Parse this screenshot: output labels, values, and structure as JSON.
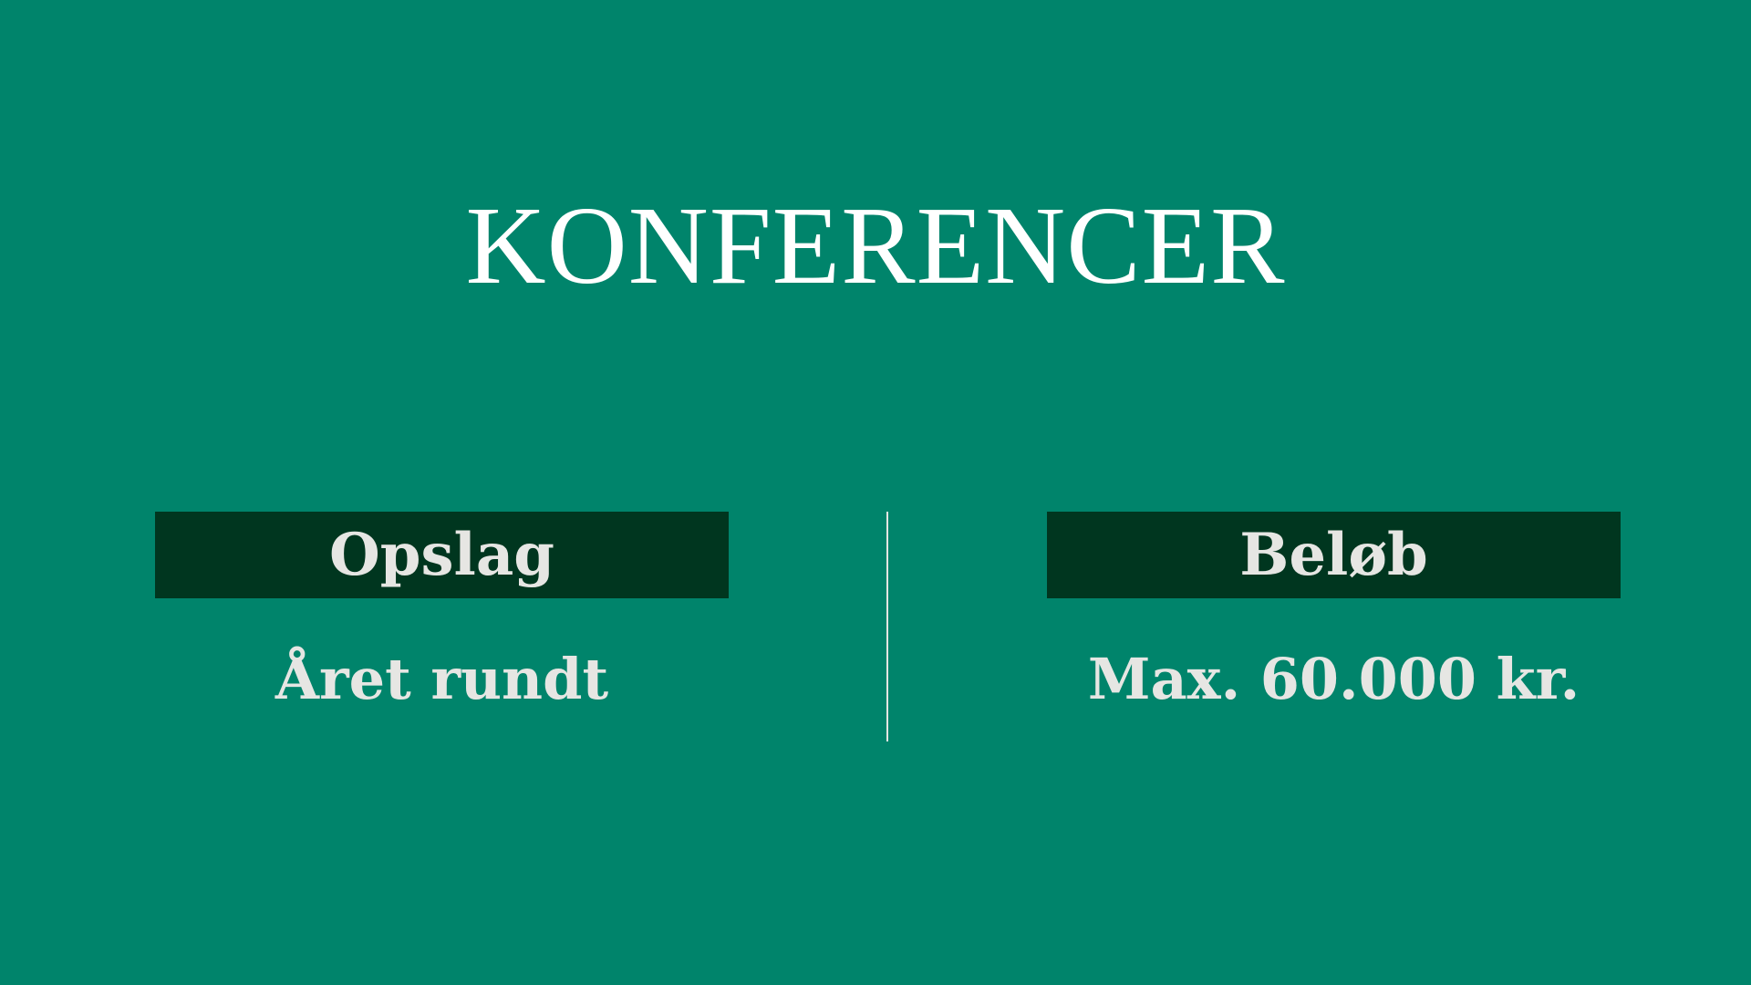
{
  "slide": {
    "title": "KONFERENCER",
    "columns": [
      {
        "header": "Opslag",
        "value": "Året rundt"
      },
      {
        "header": "Beløb",
        "value": "Max. 60.000 kr."
      }
    ]
  },
  "colors": {
    "background": "#00846b",
    "header_box": "#00361f",
    "title_text": "#ffffff",
    "body_text": "#e6e6e3"
  }
}
